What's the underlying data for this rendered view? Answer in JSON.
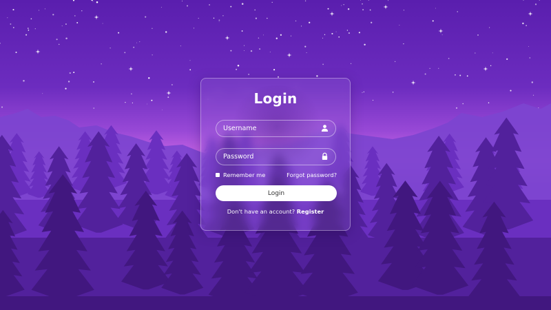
{
  "form": {
    "title": "Login",
    "username_placeholder": "Username",
    "password_placeholder": "Password",
    "remember_label": "Remember me",
    "forgot_label": "Forgot password?",
    "login_button_label": "Login",
    "register_prompt": "Don't have an account?",
    "register_link": "Register"
  },
  "icons": {
    "username": "user-icon",
    "password": "lock-icon",
    "checkbox": "checkbox-icon"
  },
  "colors": {
    "sky_top": "#5a1fb0",
    "horizon_glow": "#c05ee0",
    "card_border": "#ffffff",
    "button_bg": "#ffffff",
    "button_text": "#333333"
  }
}
